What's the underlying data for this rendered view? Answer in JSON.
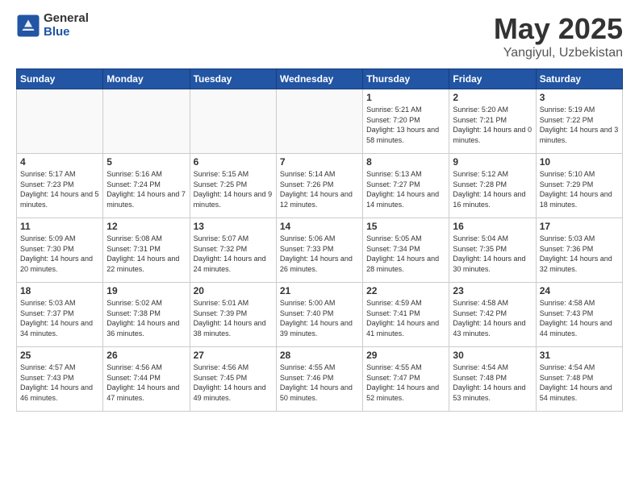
{
  "header": {
    "logo_general": "General",
    "logo_blue": "Blue",
    "title": "May 2025",
    "subtitle": "Yangiyul, Uzbekistan"
  },
  "weekdays": [
    "Sunday",
    "Monday",
    "Tuesday",
    "Wednesday",
    "Thursday",
    "Friday",
    "Saturday"
  ],
  "weeks": [
    [
      {
        "day": "",
        "info": ""
      },
      {
        "day": "",
        "info": ""
      },
      {
        "day": "",
        "info": ""
      },
      {
        "day": "",
        "info": ""
      },
      {
        "day": "1",
        "info": "Sunrise: 5:21 AM\nSunset: 7:20 PM\nDaylight: 13 hours and 58 minutes."
      },
      {
        "day": "2",
        "info": "Sunrise: 5:20 AM\nSunset: 7:21 PM\nDaylight: 14 hours and 0 minutes."
      },
      {
        "day": "3",
        "info": "Sunrise: 5:19 AM\nSunset: 7:22 PM\nDaylight: 14 hours and 3 minutes."
      }
    ],
    [
      {
        "day": "4",
        "info": "Sunrise: 5:17 AM\nSunset: 7:23 PM\nDaylight: 14 hours and 5 minutes."
      },
      {
        "day": "5",
        "info": "Sunrise: 5:16 AM\nSunset: 7:24 PM\nDaylight: 14 hours and 7 minutes."
      },
      {
        "day": "6",
        "info": "Sunrise: 5:15 AM\nSunset: 7:25 PM\nDaylight: 14 hours and 9 minutes."
      },
      {
        "day": "7",
        "info": "Sunrise: 5:14 AM\nSunset: 7:26 PM\nDaylight: 14 hours and 12 minutes."
      },
      {
        "day": "8",
        "info": "Sunrise: 5:13 AM\nSunset: 7:27 PM\nDaylight: 14 hours and 14 minutes."
      },
      {
        "day": "9",
        "info": "Sunrise: 5:12 AM\nSunset: 7:28 PM\nDaylight: 14 hours and 16 minutes."
      },
      {
        "day": "10",
        "info": "Sunrise: 5:10 AM\nSunset: 7:29 PM\nDaylight: 14 hours and 18 minutes."
      }
    ],
    [
      {
        "day": "11",
        "info": "Sunrise: 5:09 AM\nSunset: 7:30 PM\nDaylight: 14 hours and 20 minutes."
      },
      {
        "day": "12",
        "info": "Sunrise: 5:08 AM\nSunset: 7:31 PM\nDaylight: 14 hours and 22 minutes."
      },
      {
        "day": "13",
        "info": "Sunrise: 5:07 AM\nSunset: 7:32 PM\nDaylight: 14 hours and 24 minutes."
      },
      {
        "day": "14",
        "info": "Sunrise: 5:06 AM\nSunset: 7:33 PM\nDaylight: 14 hours and 26 minutes."
      },
      {
        "day": "15",
        "info": "Sunrise: 5:05 AM\nSunset: 7:34 PM\nDaylight: 14 hours and 28 minutes."
      },
      {
        "day": "16",
        "info": "Sunrise: 5:04 AM\nSunset: 7:35 PM\nDaylight: 14 hours and 30 minutes."
      },
      {
        "day": "17",
        "info": "Sunrise: 5:03 AM\nSunset: 7:36 PM\nDaylight: 14 hours and 32 minutes."
      }
    ],
    [
      {
        "day": "18",
        "info": "Sunrise: 5:03 AM\nSunset: 7:37 PM\nDaylight: 14 hours and 34 minutes."
      },
      {
        "day": "19",
        "info": "Sunrise: 5:02 AM\nSunset: 7:38 PM\nDaylight: 14 hours and 36 minutes."
      },
      {
        "day": "20",
        "info": "Sunrise: 5:01 AM\nSunset: 7:39 PM\nDaylight: 14 hours and 38 minutes."
      },
      {
        "day": "21",
        "info": "Sunrise: 5:00 AM\nSunset: 7:40 PM\nDaylight: 14 hours and 39 minutes."
      },
      {
        "day": "22",
        "info": "Sunrise: 4:59 AM\nSunset: 7:41 PM\nDaylight: 14 hours and 41 minutes."
      },
      {
        "day": "23",
        "info": "Sunrise: 4:58 AM\nSunset: 7:42 PM\nDaylight: 14 hours and 43 minutes."
      },
      {
        "day": "24",
        "info": "Sunrise: 4:58 AM\nSunset: 7:43 PM\nDaylight: 14 hours and 44 minutes."
      }
    ],
    [
      {
        "day": "25",
        "info": "Sunrise: 4:57 AM\nSunset: 7:43 PM\nDaylight: 14 hours and 46 minutes."
      },
      {
        "day": "26",
        "info": "Sunrise: 4:56 AM\nSunset: 7:44 PM\nDaylight: 14 hours and 47 minutes."
      },
      {
        "day": "27",
        "info": "Sunrise: 4:56 AM\nSunset: 7:45 PM\nDaylight: 14 hours and 49 minutes."
      },
      {
        "day": "28",
        "info": "Sunrise: 4:55 AM\nSunset: 7:46 PM\nDaylight: 14 hours and 50 minutes."
      },
      {
        "day": "29",
        "info": "Sunrise: 4:55 AM\nSunset: 7:47 PM\nDaylight: 14 hours and 52 minutes."
      },
      {
        "day": "30",
        "info": "Sunrise: 4:54 AM\nSunset: 7:48 PM\nDaylight: 14 hours and 53 minutes."
      },
      {
        "day": "31",
        "info": "Sunrise: 4:54 AM\nSunset: 7:48 PM\nDaylight: 14 hours and 54 minutes."
      }
    ]
  ]
}
